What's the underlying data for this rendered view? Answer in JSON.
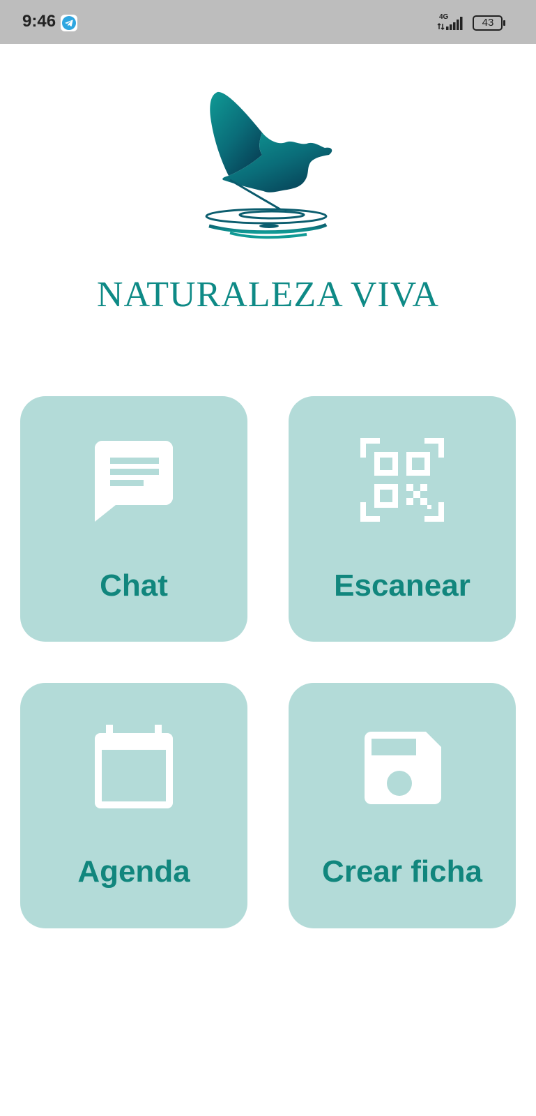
{
  "status_bar": {
    "time": "9:46",
    "network": "4G",
    "battery": "43",
    "background_color": "#bdbdbd",
    "notification_icon": "telegram-icon"
  },
  "brand": {
    "name": "NATURALEZA VIVA",
    "logo": "butterfly-logo",
    "color": "#0e8a86"
  },
  "menu": {
    "tile_color": "#b3dbd8",
    "label_color": "#11867d",
    "items": [
      {
        "label": "Chat",
        "icon": "chat-icon"
      },
      {
        "label": "Escanear",
        "icon": "qr-scan-icon"
      },
      {
        "label": "Agenda",
        "icon": "calendar-icon"
      },
      {
        "label": "Crear ficha",
        "icon": "save-icon"
      }
    ]
  }
}
